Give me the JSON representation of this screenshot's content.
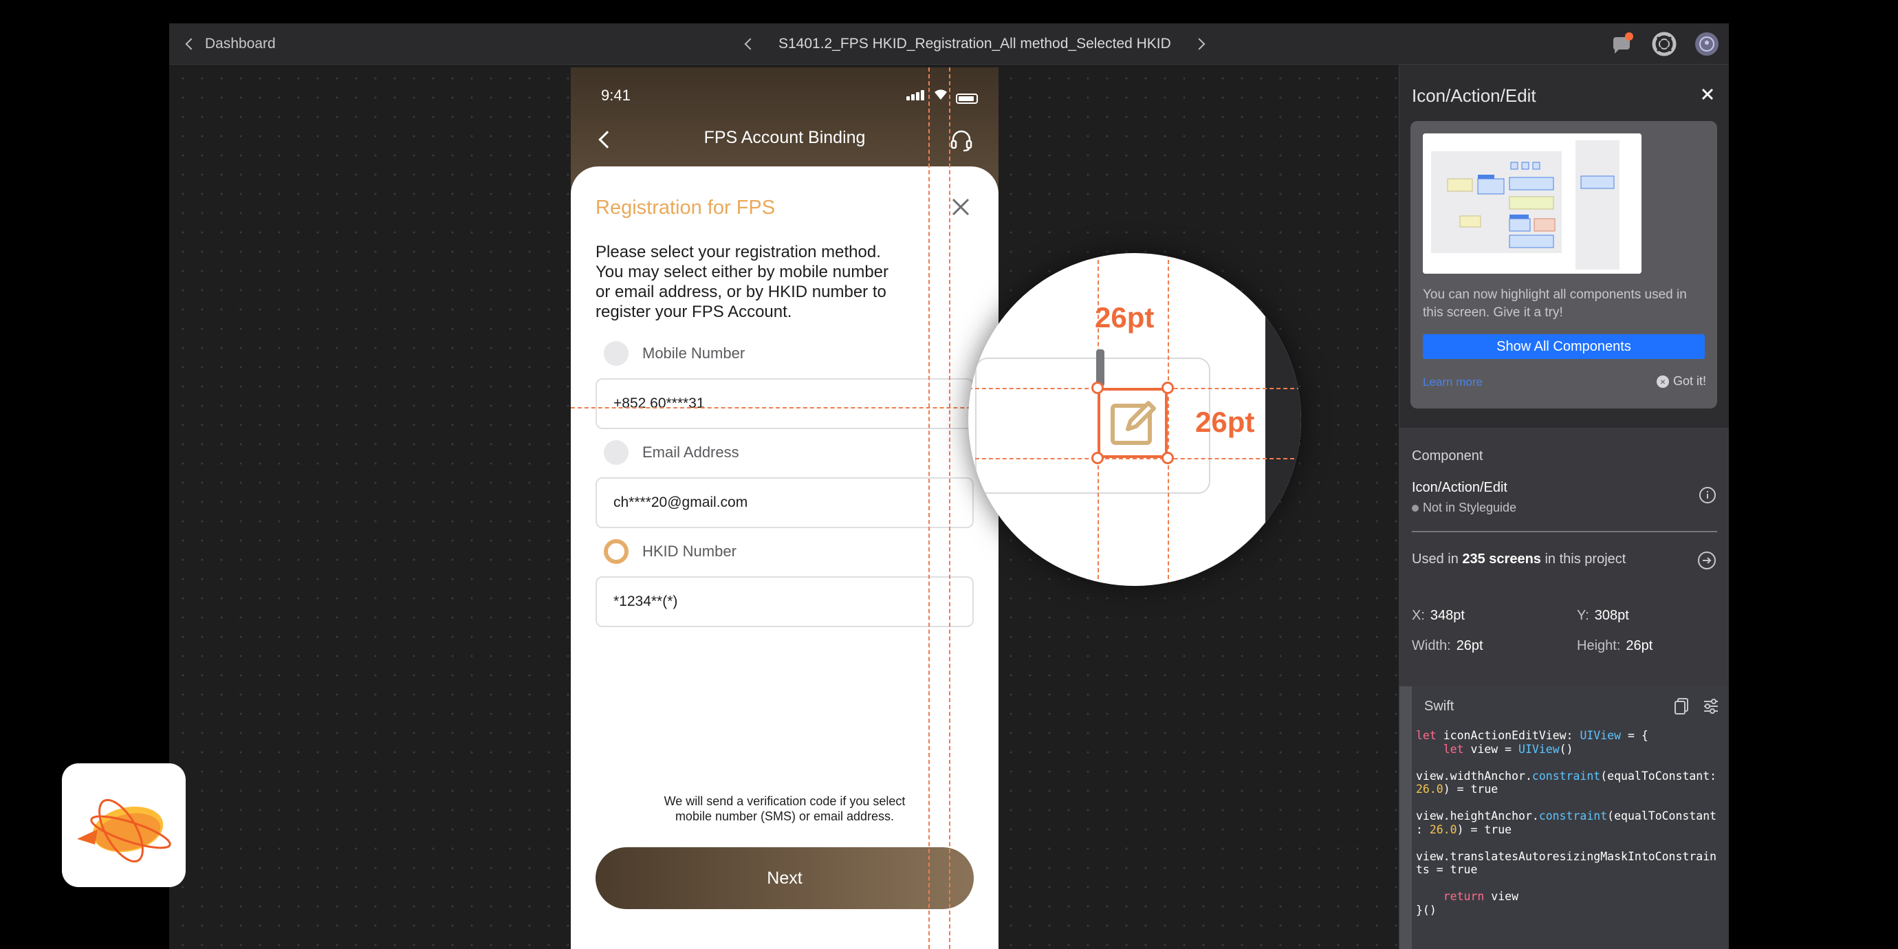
{
  "topbar": {
    "back_label": "Dashboard",
    "screen_title": "S1401.2_FPS HKID_Registration_All method_Selected HKID"
  },
  "phone": {
    "time": "9:41",
    "nav_title": "FPS Account Binding",
    "sheet": {
      "title": "Registration for FPS",
      "description": "Please select your registration method. You may select either by mobile number or email address, or by HKID number to register your FPS Account.",
      "options": [
        {
          "label": "Mobile Number",
          "value": "+852 60****31",
          "selected": false
        },
        {
          "label": "Email Address",
          "value": "ch****20@gmail.com",
          "selected": false
        },
        {
          "label": "HKID Number",
          "value": "*1234**(*)",
          "selected": true
        }
      ],
      "footnote_line1": "We will send a verification code if you select",
      "footnote_line2": "mobile number (SMS) or email address.",
      "next_label": "Next"
    }
  },
  "magnifier": {
    "width_label": "26pt",
    "height_label": "26pt"
  },
  "inspector": {
    "title": "Icon/Action/Edit",
    "tip": {
      "text": "You can now highlight all components used in this screen. Give it a try!",
      "button": "Show All Components",
      "learn_more": "Learn more",
      "got_it": "Got it!"
    },
    "component": {
      "section_label": "Component",
      "name": "Icon/Action/Edit",
      "status": "Not in Styleguide",
      "used_prefix": "Used in",
      "used_count": "235 screens",
      "used_suffix": "in this project"
    },
    "metrics": {
      "x_label": "X:",
      "x_value": "348pt",
      "y_label": "Y:",
      "y_value": "308pt",
      "w_label": "Width:",
      "w_value": "26pt",
      "h_label": "Height:",
      "h_value": "26pt"
    },
    "code": {
      "language": "Swift"
    }
  },
  "colors": {
    "accent_orange": "#ef6b3a",
    "brand_gold": "#e9a95a",
    "primary_blue": "#1f72ff"
  }
}
